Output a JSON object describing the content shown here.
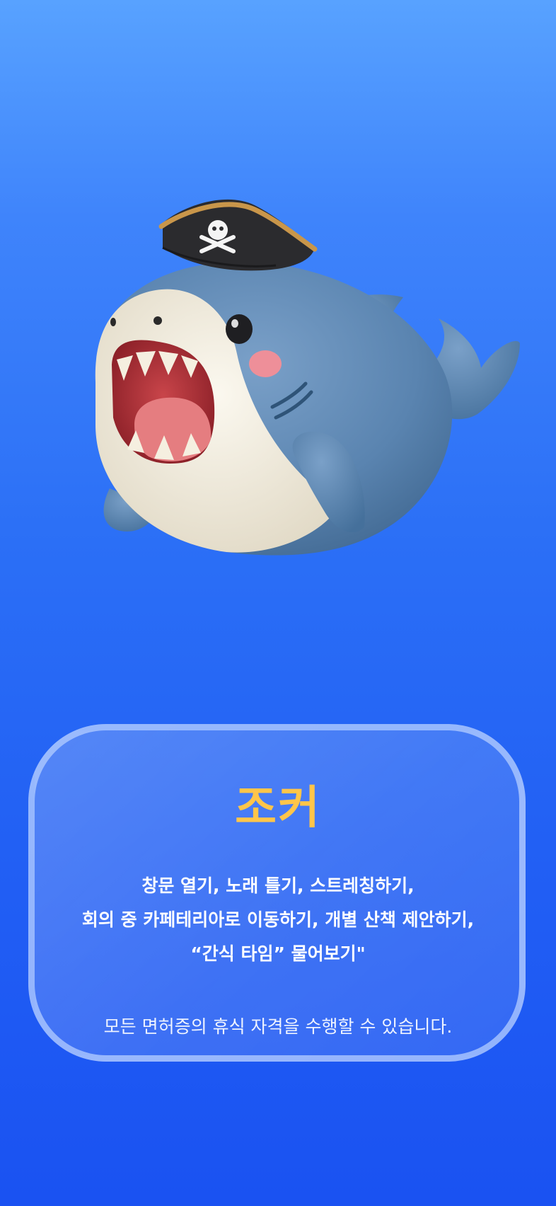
{
  "character": {
    "image": "pirate-shark-mascot-icon",
    "name": "조커",
    "description_lines": [
      "창문 열기, 노래 틀기, 스트레칭하기,",
      "회의 중 카페테리아로 이동하기, 개별 산책 제안하기,",
      "“간식 타임” 물어보기\""
    ],
    "footnote": "모든 면허증의 휴식 자격을 수행할 수 있습니다."
  },
  "colors": {
    "title": "#ffc54a",
    "background_top": "#58a2ff",
    "background_bottom": "#1a52f2",
    "shark_body": "#5a84b0",
    "shark_belly": "#f1ecdf"
  }
}
